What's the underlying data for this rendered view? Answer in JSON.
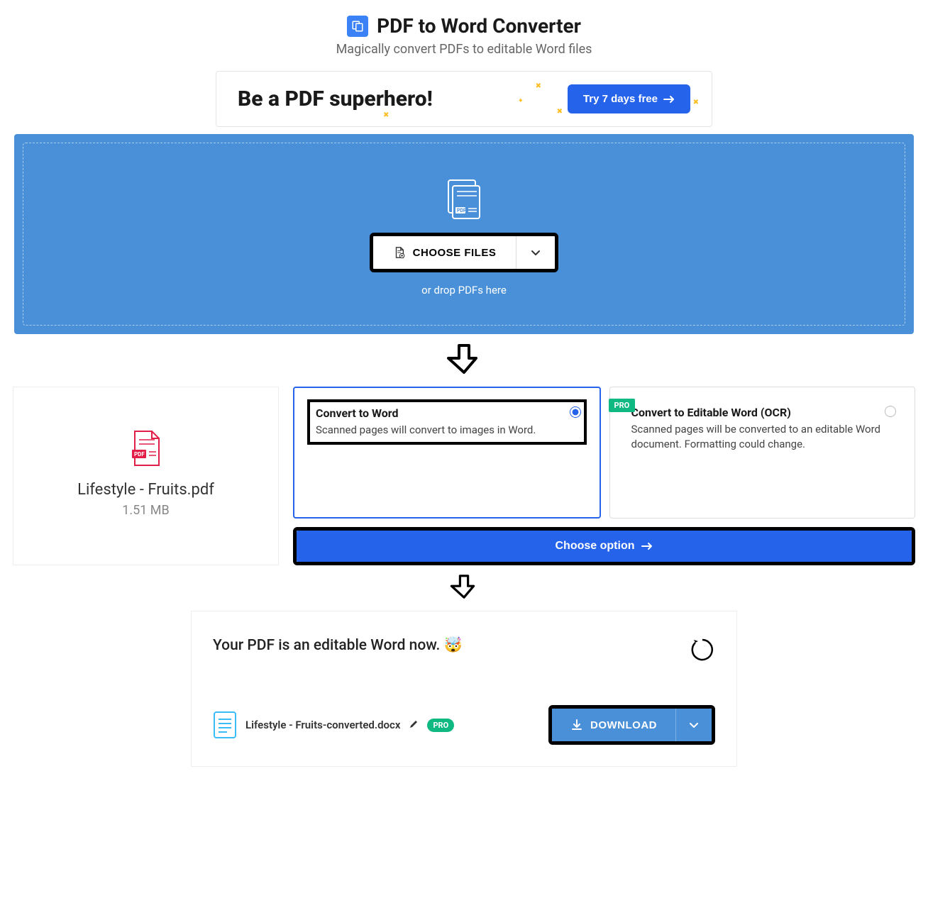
{
  "header": {
    "title": "PDF to Word Converter",
    "subtitle": "Magically convert PDFs to editable Word files"
  },
  "banner": {
    "text": "Be a PDF superhero!",
    "cta": "Try 7 days free"
  },
  "dropzone": {
    "choose_label": "CHOOSE FILES",
    "drop_text": "or drop PDFs here"
  },
  "file": {
    "name": "Lifestyle - Fruits.pdf",
    "size": "1.51 MB"
  },
  "options": {
    "opt1": {
      "title": "Convert to Word",
      "desc": "Scanned pages will convert to images in Word."
    },
    "opt2": {
      "title": "Convert to Editable Word (OCR)",
      "desc": "Scanned pages will be converted to an editable Word document. Formatting could change.",
      "badge": "PRO"
    },
    "choose_btn": "Choose option"
  },
  "result": {
    "message": "Your PDF is an editable Word now. 🤯",
    "filename": "Lifestyle - Fruits-converted.docx",
    "pro_badge": "PRO",
    "download_label": "DOWNLOAD"
  }
}
